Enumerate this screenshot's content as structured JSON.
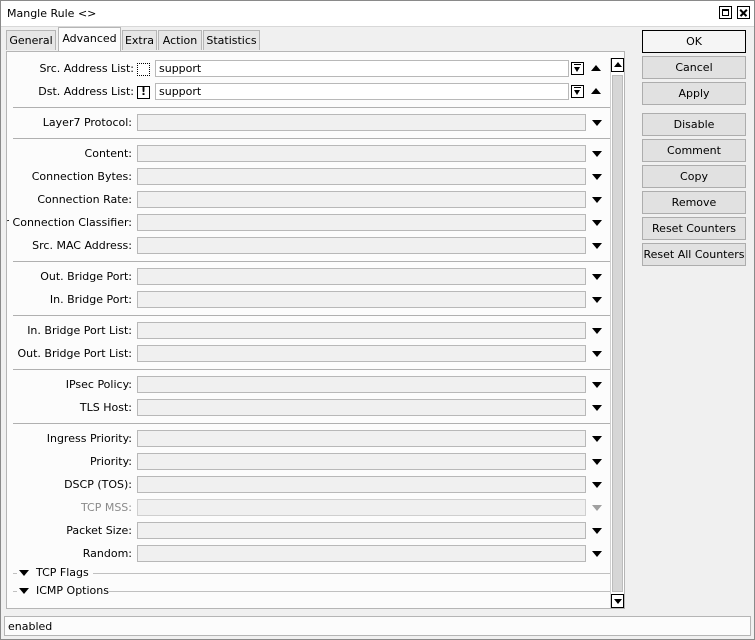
{
  "window": {
    "title": "Mangle Rule <>"
  },
  "tabs": [
    {
      "label": "General"
    },
    {
      "label": "Advanced"
    },
    {
      "label": "Extra"
    },
    {
      "label": "Action"
    },
    {
      "label": "Statistics"
    }
  ],
  "active_tab": "Advanced",
  "fields": {
    "src_address_list": {
      "label": "Src. Address List:",
      "value": "support",
      "negate": ""
    },
    "dst_address_list": {
      "label": "Dst. Address List:",
      "value": "support",
      "negate": "!"
    },
    "layer7_protocol": {
      "label": "Layer7 Protocol:"
    },
    "content": {
      "label": "Content:"
    },
    "connection_bytes": {
      "label": "Connection Bytes:"
    },
    "connection_rate": {
      "label": "Connection Rate:"
    },
    "per_connection_classifier": {
      "label": "Per Connection Classifier:"
    },
    "src_mac_address": {
      "label": "Src. MAC Address:"
    },
    "out_bridge_port": {
      "label": "Out. Bridge Port:"
    },
    "in_bridge_port": {
      "label": "In. Bridge Port:"
    },
    "in_bridge_port_list": {
      "label": "In. Bridge Port List:"
    },
    "out_bridge_port_list": {
      "label": "Out. Bridge Port List:"
    },
    "ipsec_policy": {
      "label": "IPsec Policy:"
    },
    "tls_host": {
      "label": "TLS Host:"
    },
    "ingress_priority": {
      "label": "Ingress Priority:"
    },
    "priority": {
      "label": "Priority:"
    },
    "dscp_tos": {
      "label": "DSCP (TOS):"
    },
    "tcp_mss": {
      "label": "TCP MSS:"
    },
    "packet_size": {
      "label": "Packet Size:"
    },
    "random": {
      "label": "Random:"
    }
  },
  "sections": {
    "tcp_flags": "TCP Flags",
    "icmp_options": "ICMP Options"
  },
  "buttons": {
    "ok": "OK",
    "cancel": "Cancel",
    "apply": "Apply",
    "disable": "Disable",
    "comment": "Comment",
    "copy": "Copy",
    "remove": "Remove",
    "reset_counters": "Reset Counters",
    "reset_all_counters": "Reset All Counters"
  },
  "status": {
    "text": "enabled"
  },
  "colors": {
    "window_bg": "#f0f0f0",
    "panel_bg": "#fcfcfc",
    "disabled_text": "#8a8a8a"
  }
}
